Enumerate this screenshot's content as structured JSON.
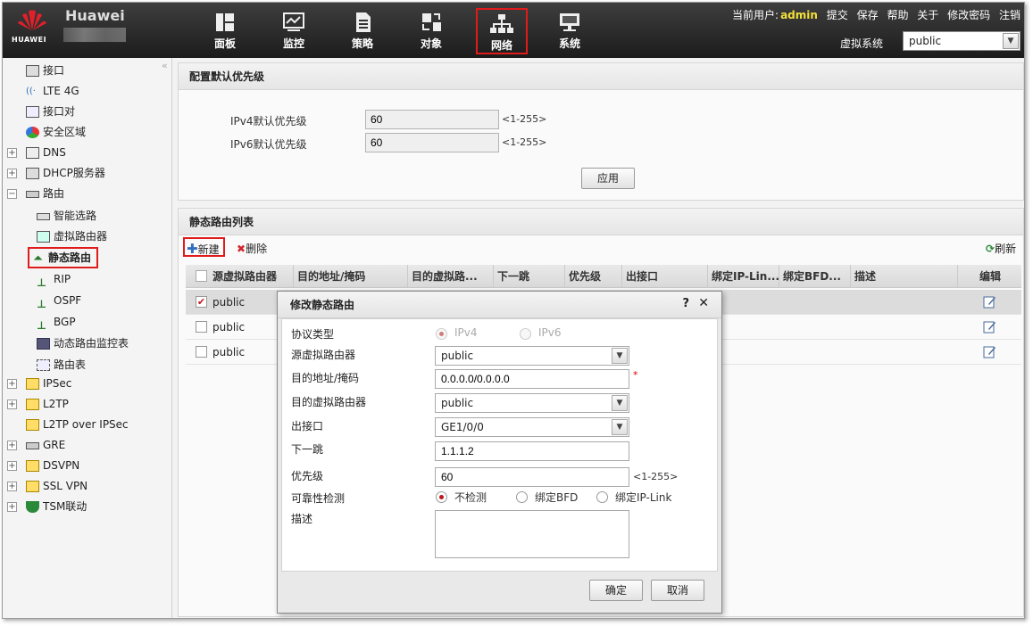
{
  "header": {
    "brand": "Huawei",
    "logo_text": "HUAWEI",
    "nav": [
      {
        "label": "面板",
        "icon": "dashboard-icon"
      },
      {
        "label": "监控",
        "icon": "monitor-icon"
      },
      {
        "label": "策略",
        "icon": "policy-icon"
      },
      {
        "label": "对象",
        "icon": "object-icon"
      },
      {
        "label": "网络",
        "icon": "network-icon",
        "active": true
      },
      {
        "label": "系统",
        "icon": "system-icon"
      }
    ],
    "user_prefix": "当前用户:",
    "user_name": "admin",
    "links": [
      "提交",
      "保存",
      "帮助",
      "关于",
      "修改密码",
      "注销"
    ],
    "vsys_label": "虚拟系统",
    "vsys_value": "public"
  },
  "sidebar": {
    "collapse": "«",
    "items": [
      {
        "label": "接口"
      },
      {
        "label": "LTE 4G"
      },
      {
        "label": "接口对"
      },
      {
        "label": "安全区域"
      },
      {
        "label": "DNS"
      },
      {
        "label": "DHCP服务器"
      },
      {
        "label": "路由"
      },
      {
        "label": "智能选路"
      },
      {
        "label": "虚拟路由器"
      },
      {
        "label": "静态路由"
      },
      {
        "label": "RIP"
      },
      {
        "label": "OSPF"
      },
      {
        "label": "BGP"
      },
      {
        "label": "动态路由监控表"
      },
      {
        "label": "路由表"
      },
      {
        "label": "IPSec"
      },
      {
        "label": "L2TP"
      },
      {
        "label": "L2TP over IPSec"
      },
      {
        "label": "GRE"
      },
      {
        "label": "DSVPN"
      },
      {
        "label": "SSL VPN"
      },
      {
        "label": "TSM联动"
      }
    ]
  },
  "priority_panel": {
    "title": "配置默认优先级",
    "ipv4_label": "IPv4默认优先级",
    "ipv4_value": "60",
    "ipv4_hint": "<1-255>",
    "ipv6_label": "IPv6默认优先级",
    "ipv6_value": "60",
    "ipv6_hint": "<1-255>",
    "apply": "应用"
  },
  "route_list": {
    "title": "静态路由列表",
    "new": "新建",
    "delete": "删除",
    "refresh": "刷新",
    "columns": [
      "源虚拟路由器",
      "目的地址/掩码",
      "目的虚拟路...",
      "下一跳",
      "优先级",
      "出接口",
      "绑定IP-Lin...",
      "绑定BFD...",
      "描述",
      "编辑"
    ],
    "rows": [
      {
        "vrouter": "public",
        "checked": true
      },
      {
        "vrouter": "public",
        "checked": false
      },
      {
        "vrouter": "public",
        "checked": false
      }
    ]
  },
  "dialog": {
    "title": "修改静态路由",
    "help": "?",
    "close": "✕",
    "protocol_label": "协议类型",
    "protocol_ipv4": "IPv4",
    "protocol_ipv6": "IPv6",
    "src_vrouter_label": "源虚拟路由器",
    "src_vrouter_value": "public",
    "dest_label": "目的地址/掩码",
    "dest_value": "0.0.0.0/0.0.0.0",
    "required_mark": "*",
    "dest_vrouter_label": "目的虚拟路由器",
    "dest_vrouter_value": "public",
    "out_if_label": "出接口",
    "out_if_value": "GE1/0/0",
    "nexthop_label": "下一跳",
    "nexthop_value": "1.1.1.2",
    "priority_label": "优先级",
    "priority_value": "60",
    "priority_hint": "<1-255>",
    "reliability_label": "可靠性检测",
    "rel_none": "不检测",
    "rel_bfd": "绑定BFD",
    "rel_iplink": "绑定IP-Link",
    "desc_label": "描述",
    "ok": "确定",
    "cancel": "取消"
  },
  "colors": {
    "accent_red": "#e01b1b",
    "user_yellow": "#f3e13a",
    "header_dark": "#2a2a2a"
  }
}
